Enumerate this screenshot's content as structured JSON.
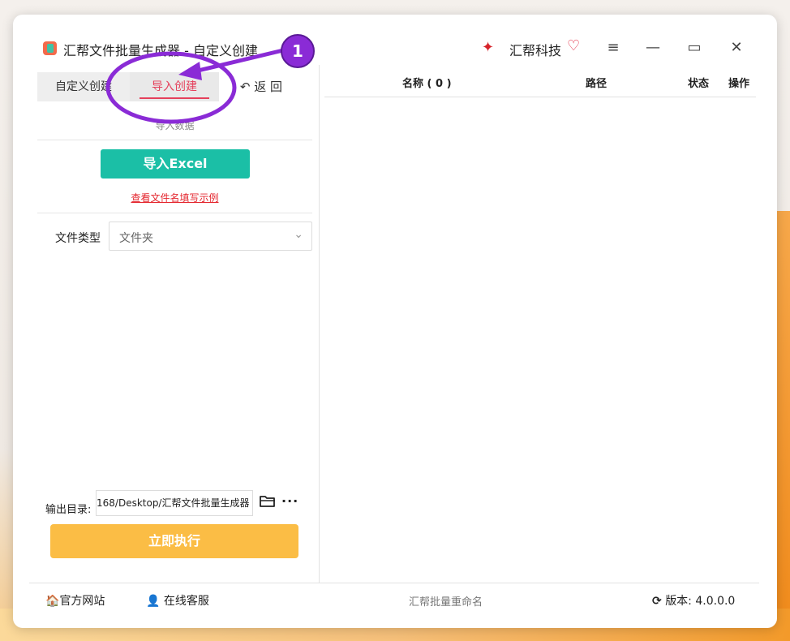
{
  "window": {
    "title": "汇帮文件批量生成器 - 自定义创建",
    "brand": "汇帮科技",
    "controls": {
      "menu": "≡",
      "minimize": "—",
      "maximize": "▭",
      "close": "✕"
    }
  },
  "tabs": {
    "custom": "自定义创建",
    "import": "导入创建",
    "back": "返 回",
    "back_icon": "↶"
  },
  "import_section": {
    "title": "导入数据",
    "button": "导入Excel",
    "example_link": "查看文件名填写示例"
  },
  "file_type": {
    "label": "文件类型",
    "value": "文件夹"
  },
  "output": {
    "label": "输出目录:",
    "path": "168/Desktop/汇帮文件批量生成器",
    "more": "···"
  },
  "execute_button": "立即执行",
  "list": {
    "columns": {
      "name": "名称 ( 0 )",
      "path": "路径",
      "status": "状态",
      "action": "操作"
    }
  },
  "footer": {
    "website": "官方网站",
    "support": "在线客服",
    "center": "汇帮批量重命名",
    "version": "版本: 4.0.0.0"
  },
  "annotation": {
    "step": "1"
  },
  "colors": {
    "accent_teal": "#1bbfa6",
    "accent_orange": "#fbbd45",
    "tab_active": "#e5405b",
    "annotation_purple": "#8a2bd6"
  },
  "icons": {
    "app": "app-logo-icon",
    "brand": "brand-logo-icon",
    "heart": "heart-icon",
    "home": "home-icon",
    "support": "support-icon",
    "refresh": "refresh-icon",
    "folder": "folder-icon",
    "chevron": "chevron-down-icon"
  }
}
